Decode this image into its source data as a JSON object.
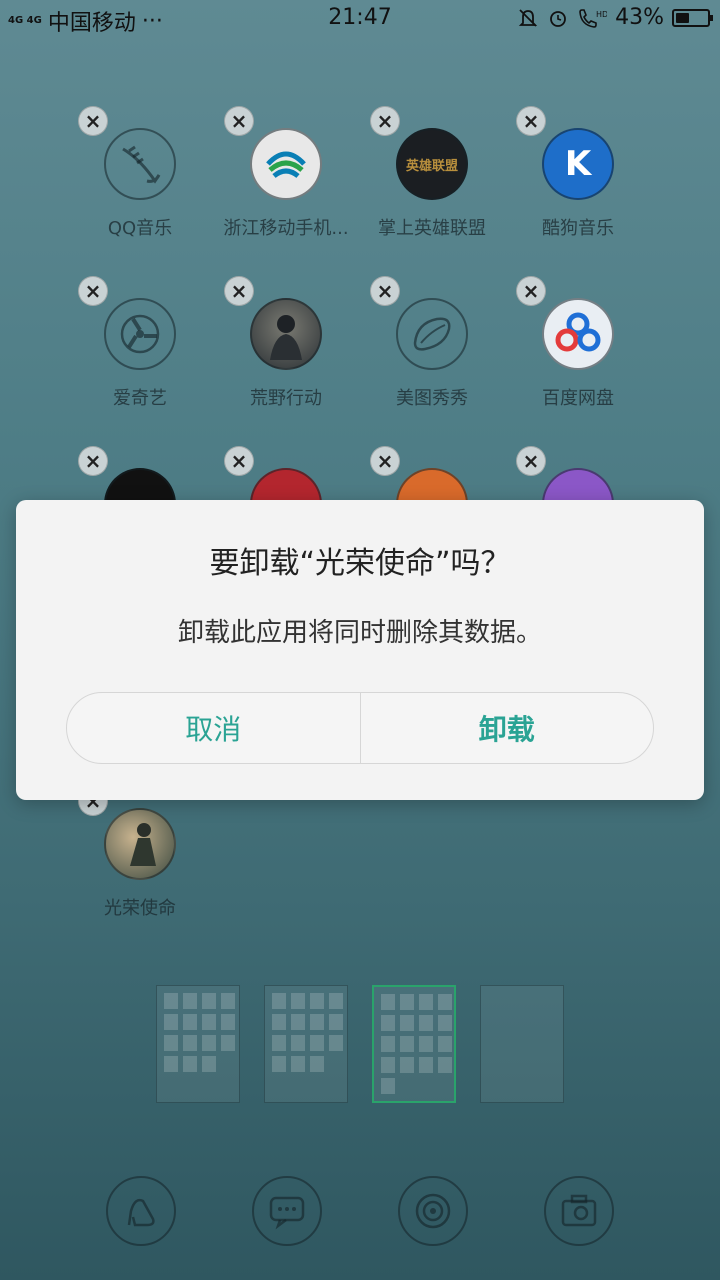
{
  "status": {
    "signal": "4G 4G",
    "carrier": "中国移动",
    "more": "···",
    "time": "21:47",
    "battery": "43%",
    "battery_level": 0.43,
    "icons": [
      "bell-mute-icon",
      "alarm-icon",
      "hd-call-icon"
    ]
  },
  "apps": [
    {
      "label": "QQ音乐",
      "icon": "qq-music-icon"
    },
    {
      "label": "浙江移动手机...",
      "icon": "china-mobile-icon"
    },
    {
      "label": "掌上英雄联盟",
      "icon": "lol-icon",
      "badge": "英雄联盟"
    },
    {
      "label": "酷狗音乐",
      "icon": "kugou-icon",
      "badge": "K"
    },
    {
      "label": "爱奇艺",
      "icon": "iqiyi-icon"
    },
    {
      "label": "荒野行动",
      "icon": "knives-out-icon"
    },
    {
      "label": "美图秀秀",
      "icon": "meitu-icon"
    },
    {
      "label": "百度网盘",
      "icon": "baidu-pan-icon"
    },
    {
      "label": "",
      "icon": "tiktok-icon"
    },
    {
      "label": "",
      "icon": "pattern-app-icon"
    },
    {
      "label": "",
      "icon": "orange-app-icon"
    },
    {
      "label": "",
      "icon": "purple-app-icon"
    },
    {
      "label": "光荣使命",
      "icon": "glorious-mission-icon"
    }
  ],
  "delete_glyph": "×",
  "dialog": {
    "title": "要卸载“光荣使命”吗？",
    "message": "卸载此应用将同时删除其数据。",
    "cancel": "取消",
    "confirm": "卸载",
    "accent": "#2aa394"
  },
  "pages": {
    "count": 4,
    "active_index": 2
  },
  "dock": [
    {
      "icon": "high-heel-icon"
    },
    {
      "icon": "message-icon"
    },
    {
      "icon": "camera-lens-icon"
    },
    {
      "icon": "camera-icon"
    }
  ]
}
